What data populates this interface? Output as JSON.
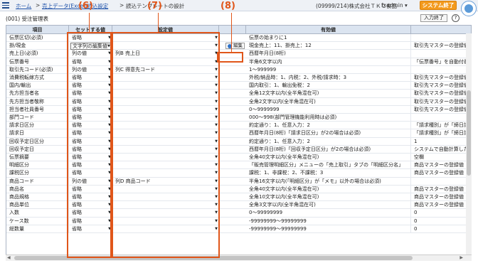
{
  "header": {
    "breadcrumb": [
      "ホーム",
      "売上データ(Excel)読込設定",
      "読込テンプレートの設計"
    ],
    "separator": ">",
    "company": "(09999/214)株式会社ＴＫＣ食品",
    "user": "fxadmin ▾",
    "exit_label": "システム終了"
  },
  "page": {
    "title": "(001) 受注管理表",
    "input_end_label": "入力終了",
    "help_label": "?"
  },
  "callouts": [
    "(6)",
    "(7)",
    "(8)"
  ],
  "table": {
    "columns": [
      "項目",
      "セットする値",
      "設定値",
      "",
      "有効値"
    ],
    "edit_label": "編集",
    "rows": [
      {
        "item": "伝票区切(必須)",
        "set": "省略",
        "config": "",
        "edit": false,
        "valid": "伝票の始まりに1",
        "note": ""
      },
      {
        "item": "掛/現金",
        "set": "文字列の編集値",
        "config": "",
        "edit": true,
        "valid": "現金売上：11、掛売上：12",
        "note": "取引先マスターの登録値"
      },
      {
        "item": "売上日(必須)",
        "set": "列の値",
        "config": "列B 売上日",
        "edit": false,
        "valid": "西暦年月日(8桁)",
        "note": ""
      },
      {
        "item": "伝票番号",
        "set": "省略",
        "config": "",
        "edit": false,
        "valid": "半角6文字以内",
        "note": "「伝票番号」を自動付番"
      },
      {
        "item": "取引先コード(必須)",
        "set": "列の値",
        "config": "列C 得意先コード",
        "edit": false,
        "valid": "1〜999999",
        "note": ""
      },
      {
        "item": "消費税転嫁方式",
        "set": "省略",
        "config": "",
        "edit": false,
        "valid": "外税/納品時：1、内税：2、外税/請求時：3",
        "note": "取引先マスターの登録値"
      },
      {
        "item": "国内/輸出",
        "set": "省略",
        "config": "",
        "edit": false,
        "valid": "国内取引：1、輸出免税：2",
        "note": "取引先マスターの登録値"
      },
      {
        "item": "先方担当者名",
        "set": "省略",
        "config": "",
        "edit": false,
        "valid": "全角12文字以内(全半角混在可)",
        "note": "取引先マスターの登録値"
      },
      {
        "item": "先方担当者敬称",
        "set": "省略",
        "config": "",
        "edit": false,
        "valid": "全角2文字以内(全半角混在可)",
        "note": "取引先マスターの登録値"
      },
      {
        "item": "担当者社員番号",
        "set": "省略",
        "config": "",
        "edit": false,
        "valid": "0〜9999999",
        "note": "取引先マスターの登録値"
      },
      {
        "item": "部門コード",
        "set": "省略",
        "config": "",
        "edit": false,
        "valid": "000〜998(部門管理機能利用時は必須)",
        "note": ""
      },
      {
        "item": "請求日区分",
        "set": "省略",
        "config": "",
        "edit": false,
        "valid": "約定通り：1、任意入力：2",
        "note": "「請求種別」が「締日請"
      },
      {
        "item": "請求日",
        "set": "省略",
        "config": "",
        "edit": false,
        "valid": "西暦年月日(8桁)「請求日区分」が2の場合は必須)",
        "note": "「請求種別」が「締日請"
      },
      {
        "item": "回収予定日区分",
        "set": "省略",
        "config": "",
        "edit": false,
        "valid": "約定通り：1、任意入力：2",
        "note": "1"
      },
      {
        "item": "回収予定日",
        "set": "省略",
        "config": "",
        "edit": false,
        "valid": "西暦年月日(8桁)「回収予定日区分」が2の場合は必須)",
        "note": "システムで自動計算した"
      },
      {
        "item": "伝票摘要",
        "set": "省略",
        "config": "",
        "edit": false,
        "valid": "全角40文字以内(全半角混在可)",
        "note": "空欄"
      },
      {
        "item": "明細区分",
        "set": "省略",
        "config": "",
        "edit": false,
        "valid": "「販売管理明細区分」メニューの「売上取引」タブの「明細区分名」",
        "note": "商品マスターの登録値"
      },
      {
        "item": "課税区分",
        "set": "省略",
        "config": "",
        "edit": false,
        "valid": "課税：1、非課税：2、不課税：3",
        "note": "商品マスターの登録値"
      },
      {
        "item": "商品コード",
        "set": "列の値",
        "config": "列D 商品コード",
        "edit": false,
        "valid": "半角16文字以内(「明細区分」が「メモ」以外の場合は必須)",
        "note": ""
      },
      {
        "item": "商品名",
        "set": "省略",
        "config": "",
        "edit": false,
        "valid": "全角40文字以内(全半角混在可)",
        "note": "商品マスターの登録値"
      },
      {
        "item": "商品規格",
        "set": "省略",
        "config": "",
        "edit": false,
        "valid": "全角10文字以内(全半角混在可)",
        "note": "商品マスターの登録値"
      },
      {
        "item": "商品単位",
        "set": "省略",
        "config": "",
        "edit": false,
        "valid": "全角3文字以内(全半角混在可)",
        "note": "商品マスターの登録値"
      },
      {
        "item": "入数",
        "set": "省略",
        "config": "",
        "edit": false,
        "valid": "0〜99999999",
        "note": "0"
      },
      {
        "item": "ケース数",
        "set": "省略",
        "config": "",
        "edit": false,
        "valid": "-99999999〜99999999",
        "note": "0"
      },
      {
        "item": "総数量",
        "set": "省略",
        "config": "",
        "edit": false,
        "valid": "-99999999〜99999999",
        "note": "0"
      }
    ]
  },
  "colors": {
    "accent": "#e0561a",
    "exit_button": "#f39a1d",
    "header_bg": "#dbe4f0",
    "link": "#1b4fa8"
  }
}
